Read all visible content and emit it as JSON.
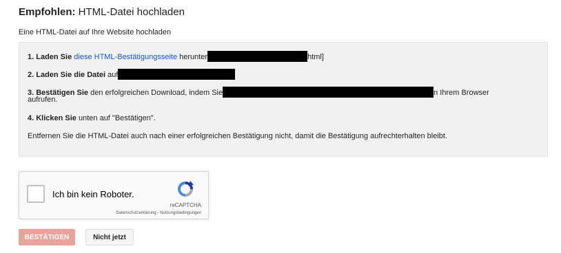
{
  "heading": {
    "bold": "Empfohlen:",
    "rest": " HTML-Datei hochladen"
  },
  "subtitle": "Eine HTML-Datei auf Ihre Website hochladen",
  "steps": {
    "s1": {
      "bold": "1. Laden Sie",
      "link": "diese HTML-Bestätigungsseite",
      "text": " herunter",
      "tail": "html]"
    },
    "s2": {
      "bold": "2. Laden Sie die Datei",
      "text": " auf"
    },
    "s3": {
      "bold": "3. Bestätigen Sie",
      "text": " den erfolgreichen Download, indem Sie",
      "tail": "n Ihrem Browser",
      "line2": "aufrufen."
    },
    "s4": {
      "bold": "4. Klicken Sie",
      "text": " unten auf \"Bestätigen\"."
    },
    "note": "Entfernen Sie die HTML-Datei auch nach einer erfolgreichen Bestätigung nicht, damit die Bestätigung aufrechterhalten bleibt."
  },
  "recaptcha": {
    "label": "Ich bin kein Roboter.",
    "brand": "reCAPTCHA",
    "links": "Datenschutzerklärung - Nutzungsbedingungen",
    "checked": false
  },
  "buttons": {
    "confirm": "BESTÄTIGEN",
    "later": "Nicht jetzt"
  },
  "colors": {
    "link": "#1155cc",
    "confirm_bg": "#e8a39a",
    "box_bg": "#f1f1f1"
  }
}
